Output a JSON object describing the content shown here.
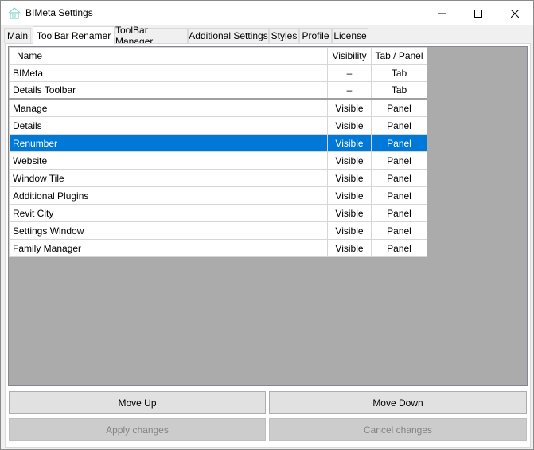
{
  "window": {
    "title": "BIMeta Settings",
    "icon": "house-icon",
    "controls": {
      "minimize": "minimize-icon",
      "maximize": "maximize-icon",
      "close": "close-icon"
    }
  },
  "tabs": [
    {
      "label": "Main",
      "active": false
    },
    {
      "label": "ToolBar Renamer",
      "active": true
    },
    {
      "label": "ToolBar Manager",
      "active": false
    },
    {
      "label": "Additional Settings",
      "active": false
    },
    {
      "label": "Styles",
      "active": false
    },
    {
      "label": "Profile",
      "active": false
    },
    {
      "label": "License",
      "active": false
    }
  ],
  "grid": {
    "columns": {
      "name": "Name",
      "visibility": "Visibility",
      "tab_panel": "Tab / Panel"
    },
    "rows": [
      {
        "name": "BIMeta",
        "visibility": "–",
        "tab_panel": "Tab"
      },
      {
        "name": "Details Toolbar",
        "visibility": "–",
        "tab_panel": "Tab"
      },
      {
        "name": "Manage",
        "visibility": "Visible",
        "tab_panel": "Panel"
      },
      {
        "name": "Details",
        "visibility": "Visible",
        "tab_panel": "Panel"
      },
      {
        "name": "Renumber",
        "visibility": "Visible",
        "tab_panel": "Panel"
      },
      {
        "name": "Website",
        "visibility": "Visible",
        "tab_panel": "Panel"
      },
      {
        "name": "Window Tile",
        "visibility": "Visible",
        "tab_panel": "Panel"
      },
      {
        "name": "Additional Plugins",
        "visibility": "Visible",
        "tab_panel": "Panel"
      },
      {
        "name": "Revit City",
        "visibility": "Visible",
        "tab_panel": "Panel"
      },
      {
        "name": "Settings Window",
        "visibility": "Visible",
        "tab_panel": "Panel"
      },
      {
        "name": "Family Manager",
        "visibility": "Visible",
        "tab_panel": "Panel"
      }
    ],
    "selected_row": "Renumber",
    "selection_color": "#0078d7"
  },
  "buttons": {
    "move_up": "Move Up",
    "move_down": "Move Down",
    "apply": "Apply changes",
    "cancel": "Cancel changes"
  }
}
